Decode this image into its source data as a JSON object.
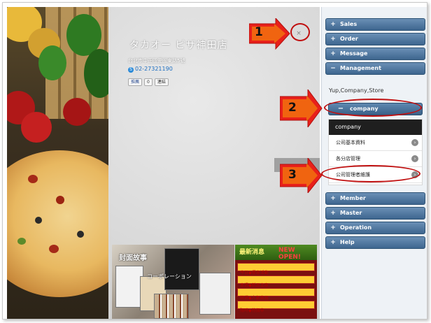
{
  "shop": {
    "title": "タカオー ピザ神田店",
    "address": "台北市中正區愛國東路5號",
    "phone": "02-27321190",
    "share_fb": "推薦",
    "share_count": "0",
    "share_link": "連結",
    "close_symbol": "×"
  },
  "banners": {
    "left_title": "封面故事",
    "left_sub": "コーポレーション",
    "right_title": "最新消息",
    "right_new": "NEW OPEN!",
    "right_rows": [
      "今日◆優惠活動",
      "本週◆新品上市",
      "精選◆人氣商品",
      "限時◆特價中"
    ]
  },
  "markers": [
    "1",
    "2",
    "3"
  ],
  "sidebar": {
    "top_items": [
      {
        "label": "Sales",
        "sign": "+"
      },
      {
        "label": "Order",
        "sign": "+"
      },
      {
        "label": "Message",
        "sign": "+"
      },
      {
        "label": "Management",
        "sign": "−"
      }
    ],
    "breadcrumb": "Yup,Company,Store",
    "company": {
      "label": "company",
      "sign": "−"
    },
    "sub_head": "company",
    "sub_items": [
      "公司基本資料",
      "各分店管理",
      "公司管理者維護"
    ],
    "go_symbol": "›",
    "bottom_items": [
      {
        "label": "Member",
        "sign": "+"
      },
      {
        "label": "Master",
        "sign": "+"
      },
      {
        "label": "Operation",
        "sign": "+"
      },
      {
        "label": "Help",
        "sign": "+"
      }
    ]
  },
  "colors": {
    "accent_red": "#c01010",
    "nav_blue": "#3e668f",
    "arrow_red": "#e8201a",
    "arrow_yellow": "#ffe600"
  }
}
